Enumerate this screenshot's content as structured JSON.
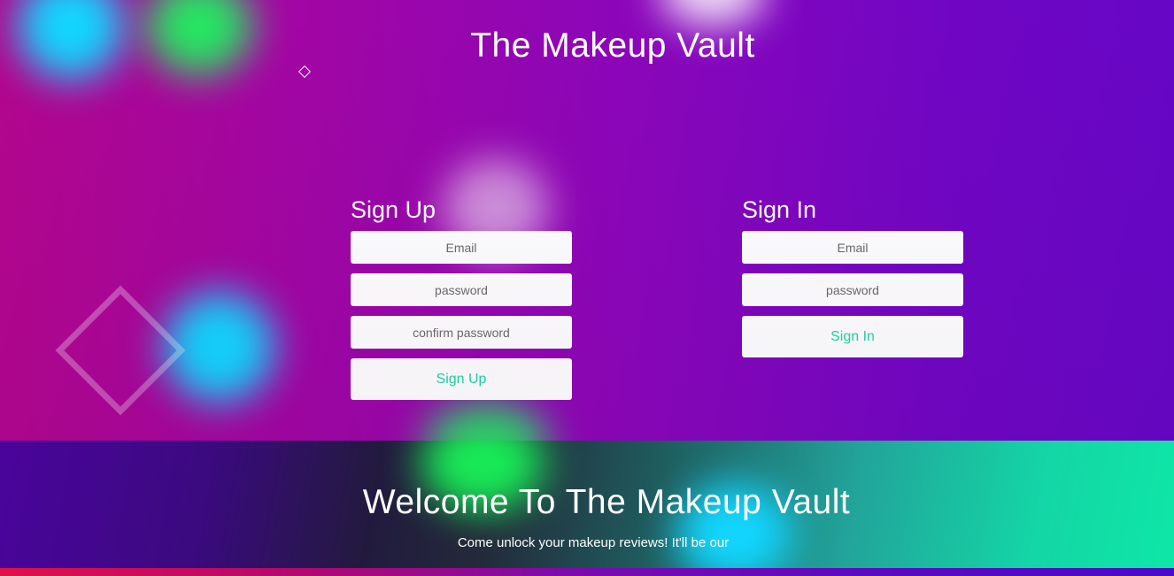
{
  "header": {
    "title": "The Makeup Vault"
  },
  "signup": {
    "heading": "Sign Up",
    "email_placeholder": "Email",
    "password_placeholder": "password",
    "confirm_placeholder": "confirm password",
    "button_label": "Sign Up"
  },
  "signin": {
    "heading": "Sign In",
    "email_placeholder": "Email",
    "password_placeholder": "password",
    "button_label": "Sign In"
  },
  "welcome": {
    "title": "Welcome To The Makeup Vault",
    "subtitle": "Come unlock your makeup reviews! It'll be our"
  },
  "colors": {
    "button_text": "#1fd6a6",
    "hero_left": "#b3068f",
    "hero_right": "#6706c6",
    "welcome_left": "#4a049c",
    "welcome_right": "#0ee7a7"
  }
}
